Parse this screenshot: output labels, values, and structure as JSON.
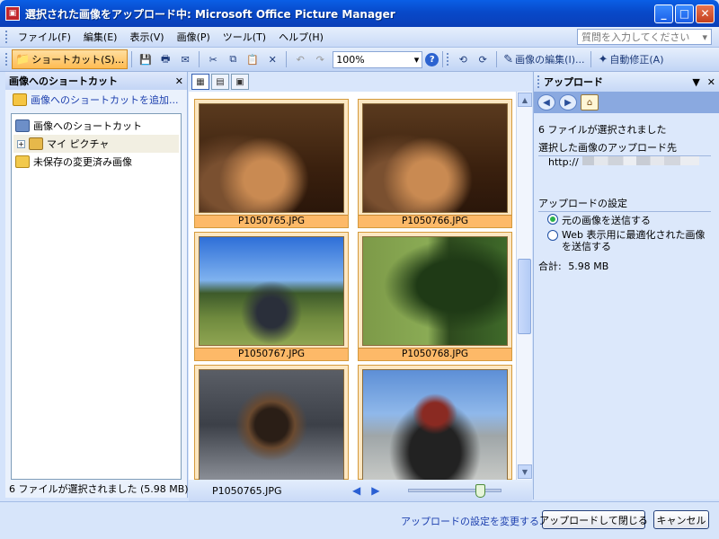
{
  "window": {
    "title": "選択された画像をアップロード中: Microsoft Office Picture Manager"
  },
  "menu": [
    "ファイル(F)",
    "編集(E)",
    "表示(V)",
    "画像(P)",
    "ツール(T)",
    "ヘルプ(H)"
  ],
  "help_search": {
    "placeholder": "質問を入力してください"
  },
  "toolbar": {
    "shortcut_label": "ショートカット(S)...",
    "zoom_value": "100%",
    "edit_picture_label": "画像の編集(I)...",
    "auto_correct_label": "自動修正(A)"
  },
  "left_pane": {
    "title": "画像へのショートカット",
    "add_shortcut": "画像へのショートカットを追加...",
    "tree": [
      {
        "label": "画像へのショートカット"
      },
      {
        "label": "マイ ピクチャ",
        "expander": "+"
      },
      {
        "label": "未保存の変更済み画像"
      }
    ],
    "status": "6 ファイルが選択されました (5.98 MB)"
  },
  "thumbnails": [
    {
      "caption": "P1050765.JPG"
    },
    {
      "caption": "P1050766.JPG"
    },
    {
      "caption": "P1050767.JPG"
    },
    {
      "caption": "P1050768.JPG"
    }
  ],
  "center_status": {
    "filename": "P1050765.JPG",
    "zoom_slider": 0.78
  },
  "right_pane": {
    "title": "アップロード",
    "selected_count": "6 ファイルが選択されました",
    "destination_label": "選択した画像のアップロード先",
    "destination_prefix": "http://",
    "settings_label": "アップロードの設定",
    "option_original": "元の画像を送信する",
    "option_web_line1": "Web 表示用に最適化された画像",
    "option_web_line2": "を送信する",
    "total_label": "合計:",
    "total_value": "5.98 MB"
  },
  "bottom": {
    "change_settings_link": "アップロードの設定を変更する...",
    "upload_close_button": "アップロードして閉じる",
    "cancel_button": "キャンセル"
  },
  "colors": {
    "title_bar": "#0a5fe6",
    "selection_orange": "#fdb968",
    "pane_bg": "#dce8fb"
  }
}
